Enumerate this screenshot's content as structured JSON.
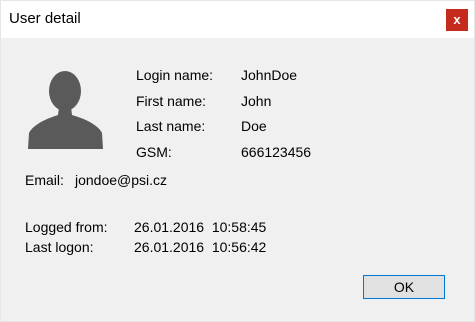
{
  "window": {
    "title": "User detail",
    "close_label": "x"
  },
  "avatar": {
    "icon": "user-silhouette-icon",
    "color": "#5a5a5a"
  },
  "user": {
    "login_name_label": "Login name:",
    "login_name_value": "JohnDoe",
    "first_name_label": "First name:",
    "first_name_value": "John",
    "last_name_label": "Last name:",
    "last_name_value": "Doe",
    "gsm_label": "GSM:",
    "gsm_value": "666123456",
    "email_label": "Email:",
    "email_value": "jondoe@psi.cz"
  },
  "session": {
    "logged_from_label": "Logged from:",
    "logged_from_value": "26.01.2016  10:58:45",
    "last_logon_label": "Last logon:",
    "last_logon_value": "26.01.2016  10:56:42"
  },
  "buttons": {
    "ok_label": "OK"
  },
  "colors": {
    "close_button": "#c42b1c",
    "focus_border": "#0078d7"
  }
}
